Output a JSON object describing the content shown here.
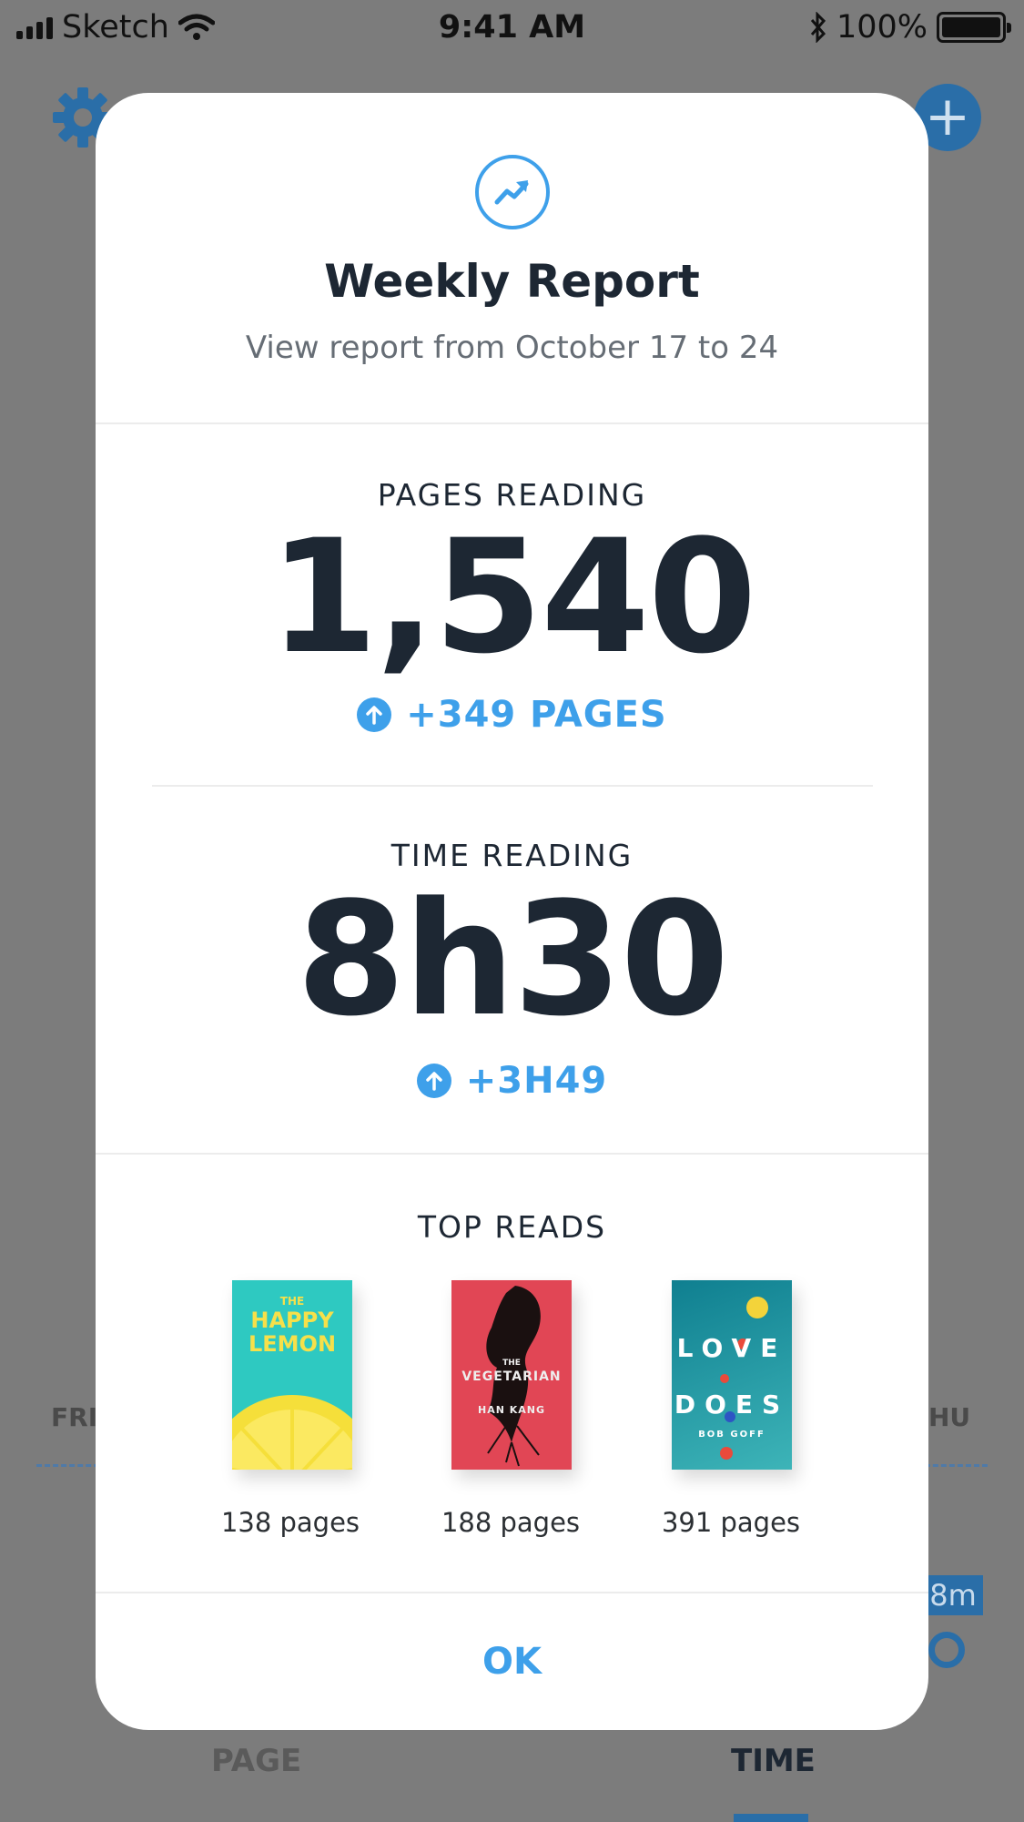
{
  "status_bar": {
    "carrier": "Sketch",
    "time": "9:41 AM",
    "battery": "100%"
  },
  "background": {
    "days": [
      "FRI",
      "HU"
    ],
    "tabs": [
      "PAGE",
      "TIME"
    ],
    "badge": "8m"
  },
  "modal": {
    "title": "Weekly Report",
    "subtitle": "View report from October 17 to 24",
    "pages_section": {
      "label": "PAGES READING",
      "value": "1,540",
      "delta": "+349 PAGES"
    },
    "time_section": {
      "label": "TIME READING",
      "value": "8h30",
      "delta": "+3H49"
    },
    "top_reads": {
      "label": "TOP READS",
      "books": [
        {
          "cover_lines": [
            "THE",
            "HAPPY",
            "LEMON"
          ],
          "pages": "138 pages",
          "color": "#2ec9c1"
        },
        {
          "cover_lines": [
            "THE",
            "VEGETARIAN",
            "HAN KANG"
          ],
          "pages": "188 pages",
          "color": "#e14655"
        },
        {
          "cover_lines": [
            "LOVE",
            "DOES",
            "BOB GOFF"
          ],
          "pages": "391 pages",
          "color": "#1a8c9c"
        }
      ]
    },
    "ok_label": "OK"
  },
  "colors": {
    "accent": "#3ea0ea",
    "text_dark": "#1d2733",
    "overlay": "#7c7c7c"
  }
}
